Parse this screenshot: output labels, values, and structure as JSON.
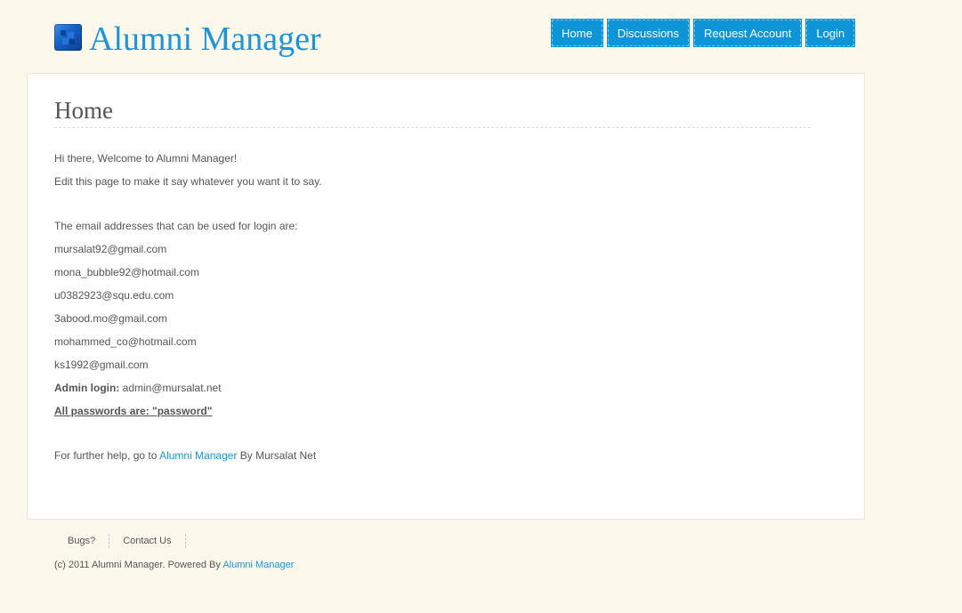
{
  "header": {
    "title": "Alumni Manager",
    "logo_icon": "alumni-logo-icon"
  },
  "nav": {
    "items": [
      {
        "label": "Home"
      },
      {
        "label": "Discussions"
      },
      {
        "label": "Request Account"
      },
      {
        "label": "Login"
      }
    ],
    "color": "#0d95d8"
  },
  "main": {
    "title": "Home",
    "welcome": "Hi there, Welcome to Alumni Manager!",
    "edit_note": "Edit this page to make it say whatever you want it to say.",
    "emails_intro": "The email addresses that can be used for login are:",
    "emails": [
      "mursalat92@gmail.com",
      "mona_bubble92@hotmail.com",
      "u0382923@squ.edu.com",
      "3abood.mo@gmail.com",
      "mohammed_co@hotmail.com",
      "ks1992@gmail.com"
    ],
    "admin_label": "Admin login:",
    "admin_email": "admin@mursalat.net",
    "passwords_note": "All passwords are: \"password\"",
    "help_prefix": "For further help, go to",
    "help_link": "Alumni Manager",
    "help_suffix": "By Mursalat Net"
  },
  "footer": {
    "links": [
      {
        "label": "Bugs?"
      },
      {
        "label": "Contact Us"
      }
    ],
    "copyright_prefix": "(c) 2011 Alumni Manager. Powered By",
    "copyright_link": "Alumni Manager"
  },
  "colors": {
    "background": "#fdf8ec",
    "accent": "#1b94d8"
  }
}
